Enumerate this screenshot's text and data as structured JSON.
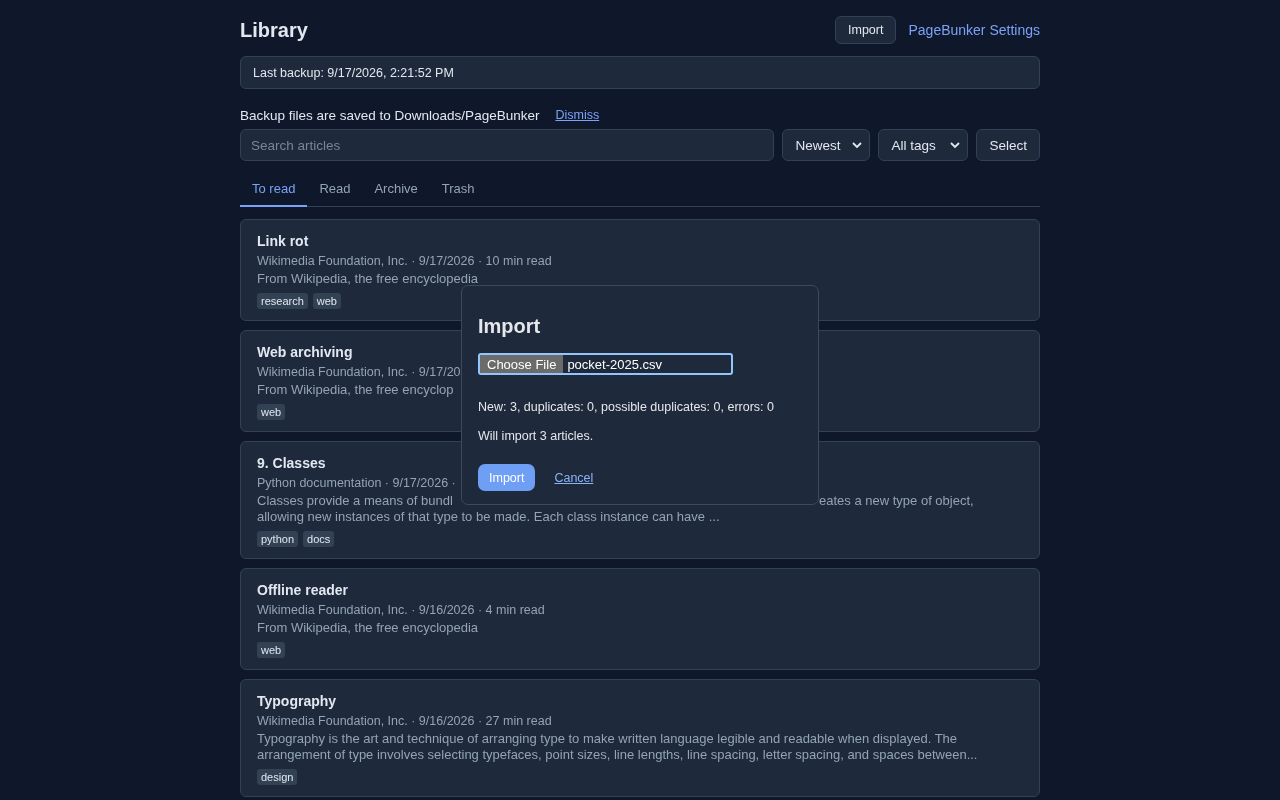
{
  "header": {
    "title": "Library",
    "import_button": "Import",
    "settings_link": "PageBunker Settings"
  },
  "backup_status": "Last backup: 9/17/2026, 2:21:52 PM",
  "notice": {
    "text": "Backup files are saved to Downloads/PageBunker",
    "dismiss": "Dismiss"
  },
  "search": {
    "placeholder": "Search articles"
  },
  "sort_select": "Newest",
  "tag_select": "All tags",
  "select_button": "Select",
  "tabs": [
    {
      "label": "To read",
      "selected": true
    },
    {
      "label": "Read",
      "selected": false
    },
    {
      "label": "Archive",
      "selected": false
    },
    {
      "label": "Trash",
      "selected": false
    }
  ],
  "articles": [
    {
      "title": "Link rot",
      "meta": "Wikimedia Foundation, Inc. · 9/17/2026 · 10 min read",
      "description_lines": [
        [
          "From Wikipedia, the free encyclopedia"
        ]
      ],
      "tags": [
        "research",
        "web"
      ]
    },
    {
      "title": "Web archiving",
      "meta": "Wikimedia Foundation, Inc. · 9/17/20",
      "description_lines": [
        [
          "From Wikipedia, the free encyclop"
        ]
      ],
      "tags": [
        "web"
      ]
    },
    {
      "title": "9. Classes",
      "meta": "Python documentation · 9/17/2026 ·",
      "description_lines": [
        [
          "Classes provide a means of bundl",
          "eates a new type of object,"
        ],
        [
          "allowing new instances of that type to be made. Each class instance can have ..."
        ]
      ],
      "tags": [
        "python",
        "docs"
      ]
    },
    {
      "title": "Offline reader",
      "meta": "Wikimedia Foundation, Inc. · 9/16/2026 · 4 min read",
      "description_lines": [
        [
          "From Wikipedia, the free encyclopedia"
        ]
      ],
      "tags": [
        "web"
      ]
    },
    {
      "title": "Typography",
      "meta": "Wikimedia Foundation, Inc. · 9/16/2026 · 27 min read",
      "description_lines": [
        [
          "Typography is the art and technique of arranging type to make written language legible and readable when displayed. The arrangement of type involves selecting typefaces, point sizes, line lengths, line spacing, letter spacing, and spaces between..."
        ]
      ],
      "tags": [
        "design"
      ]
    }
  ],
  "dialog": {
    "title": "Import",
    "file_button": "Choose File",
    "file_name": "pocket-2025.csv",
    "summary": "New: 3, duplicates: 0, possible duplicates: 0, errors: 0",
    "message": "Will import 3 articles.",
    "import_button": "Import",
    "cancel_link": "Cancel"
  }
}
